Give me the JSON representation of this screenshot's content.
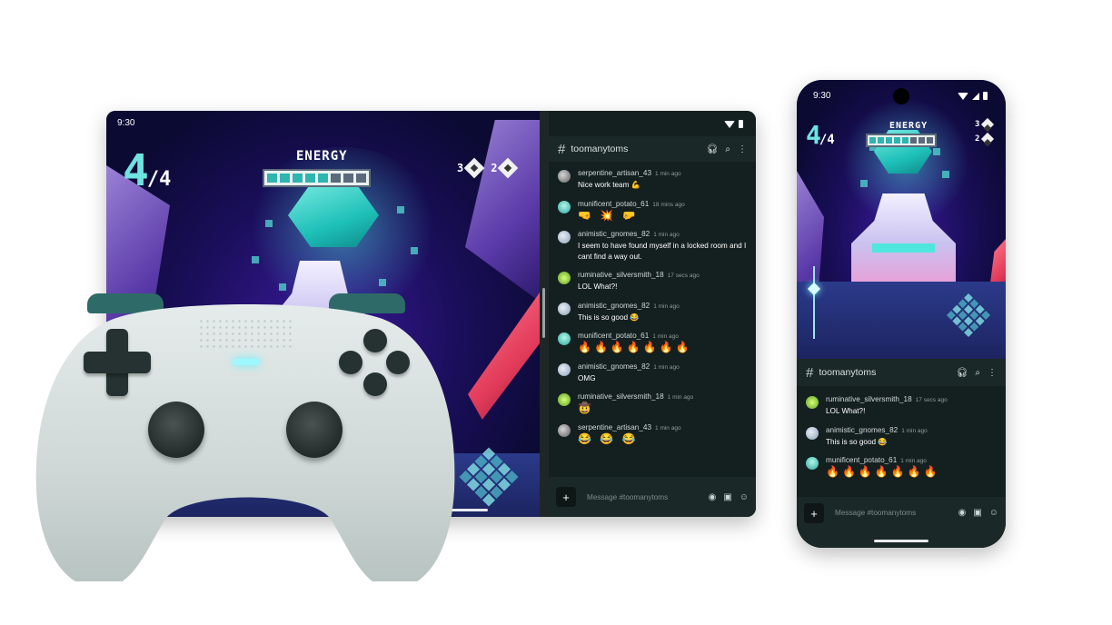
{
  "tablet": {
    "status_time": "9:30",
    "game": {
      "lives_current": "4",
      "lives_total": "/4",
      "energy_label": "ENERGY",
      "energy_level": 0.625,
      "hud_bolts": "3",
      "hud_shields": "2"
    },
    "chat": {
      "channel": "toomanytoms",
      "messages": [
        {
          "user": "serpentine_artisan_43",
          "time": "1 min ago",
          "text": "Nice work team 💪",
          "avatar": "a"
        },
        {
          "user": "munificent_potato_61",
          "time": "18 mins ago",
          "text": "🤜 💥 🤛",
          "avatar": "b",
          "emoji": true
        },
        {
          "user": "animistic_gnomes_82",
          "time": "1 min ago",
          "text": "I seem to have found myself in a locked room and I cant find a way out.",
          "avatar": "c"
        },
        {
          "user": "ruminative_silversmith_18",
          "time": "17 secs ago",
          "text": "LOL What?!",
          "avatar": "d"
        },
        {
          "user": "animistic_gnomes_82",
          "time": "1 min ago",
          "text": "This is so good 😂",
          "avatar": "c"
        },
        {
          "user": "munificent_potato_61",
          "time": "1 min ago",
          "text": "🔥🔥🔥🔥🔥🔥🔥",
          "avatar": "b",
          "emoji": true
        },
        {
          "user": "animistic_gnomes_82",
          "time": "1 min ago",
          "text": "OMG",
          "avatar": "c"
        },
        {
          "user": "ruminative_silversmith_18",
          "time": "1 min ago",
          "text": "🤠",
          "avatar": "d",
          "emoji": true
        },
        {
          "user": "serpentine_artisan_43",
          "time": "1 min ago",
          "text": "😂 😂 😂",
          "avatar": "a",
          "emoji": true
        }
      ],
      "composer_placeholder": "Message #toomanytoms"
    }
  },
  "phone": {
    "status_time": "9:30",
    "game": {
      "lives_current": "4",
      "lives_total": "/4",
      "energy_label": "ENERGY",
      "energy_level": 0.625,
      "hud_bolts": "3",
      "hud_shields": "2"
    },
    "chat": {
      "channel": "toomanytoms",
      "messages": [
        {
          "user": "ruminative_silversmith_18",
          "time": "17 secs ago",
          "text": "LOL What?!",
          "avatar": "d"
        },
        {
          "user": "animistic_gnomes_82",
          "time": "1 min ago",
          "text": "This is so good 😂",
          "avatar": "c"
        },
        {
          "user": "munificent_potato_61",
          "time": "1 min ago",
          "text": "🔥🔥🔥🔥🔥🔥🔥",
          "avatar": "b",
          "emoji": true
        }
      ],
      "composer_placeholder": "Message #toomanytoms"
    }
  },
  "icons": {
    "channel": "hashtag-icon",
    "headphones": "headphones-icon",
    "search": "search-icon",
    "more": "more-vert-icon",
    "add": "plus-icon",
    "camera": "camera-icon",
    "image": "image-icon",
    "emoji": "emoji-icon"
  },
  "colors": {
    "accent": "#6fe3e0",
    "chat_bg": "#141f1f",
    "controller": "#dfe7e6"
  }
}
